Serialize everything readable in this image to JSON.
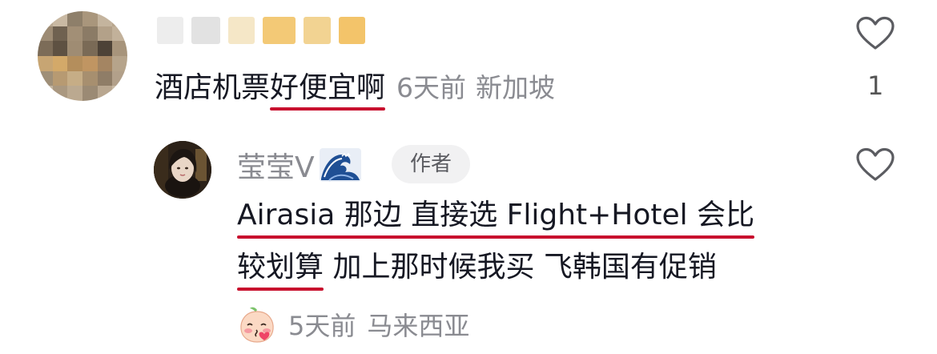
{
  "comment": {
    "text_plain": "酒店机票",
    "text_underlined": "好便宜啊",
    "time": "6天前",
    "location": "新加坡",
    "like_count": "1"
  },
  "reply": {
    "username": "莹莹V",
    "author_tag": "作者",
    "line1_underlined": "Airasia 那边 直接选 Flight+Hotel 会比",
    "line2_underlined": "较划算",
    "line2_rest": " 加上那时候我买 飞韩国有促销",
    "time": "5天前",
    "location": "马来西亚"
  },
  "colors": {
    "underline": "#c8102e",
    "meta_gray": "#8a8b91",
    "text": "#161823",
    "tag_bg": "#f1f1f2"
  },
  "icons": [
    "heart-outline-icon",
    "wave-emoji-icon",
    "peach-blush-emoji-icon"
  ]
}
